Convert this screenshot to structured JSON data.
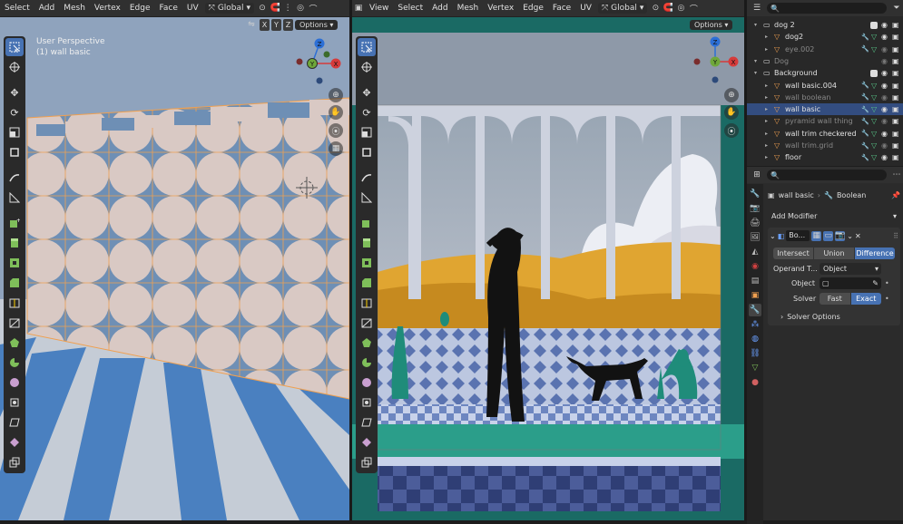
{
  "left_header": {
    "menus": [
      "Select",
      "Add",
      "Mesh",
      "Vertex",
      "Edge",
      "Face",
      "UV"
    ],
    "transform_orientation": "Global",
    "options_label": "Options",
    "axes": [
      "X",
      "Y",
      "Z"
    ]
  },
  "left_viewport": {
    "view_name": "User Perspective",
    "object_label": "(1) wall basic"
  },
  "right_header": {
    "menus": [
      "View",
      "Select",
      "Add",
      "Mesh",
      "Vertex",
      "Edge",
      "Face",
      "UV"
    ],
    "transform_orientation": "Global",
    "options_label": "Options"
  },
  "gizmo": {
    "x": "X",
    "y": "Y",
    "z": "Z"
  },
  "outliner": {
    "rows": [
      {
        "name": "dog 2",
        "type": "collection",
        "indent": 0,
        "checked": true
      },
      {
        "name": "dog2",
        "type": "object",
        "indent": 1
      },
      {
        "name": "eye.002",
        "type": "object",
        "indent": 1,
        "dim": true
      },
      {
        "name": "Dog",
        "type": "collection",
        "indent": 0,
        "dim": true
      },
      {
        "name": "Background",
        "type": "collection",
        "indent": 0,
        "checked": true
      },
      {
        "name": "wall basic.004",
        "type": "object",
        "indent": 1
      },
      {
        "name": "wall boolean",
        "type": "object",
        "indent": 1,
        "dim": true
      },
      {
        "name": "wall basic",
        "type": "object",
        "indent": 1,
        "selected": true
      },
      {
        "name": "pyramid wall thing",
        "type": "object",
        "indent": 1,
        "dim": true
      },
      {
        "name": "wall trim checkered",
        "type": "object",
        "indent": 1
      },
      {
        "name": "wall trim.grid",
        "type": "object",
        "indent": 1,
        "dim": true
      },
      {
        "name": "floor",
        "type": "object",
        "indent": 1
      }
    ]
  },
  "properties": {
    "breadcrumb_object": "wall basic",
    "breadcrumb_modifier": "Boolean",
    "add_modifier_label": "Add Modifier",
    "modifier_name": "Bo...",
    "operations": [
      "Intersect",
      "Union",
      "Difference"
    ],
    "active_operation": "Difference",
    "operand_label": "Operand T...",
    "operand_value": "Object",
    "object_label": "Object",
    "object_value": "",
    "solver_label": "Solver",
    "solvers": [
      "Fast",
      "Exact"
    ],
    "active_solver": "Exact",
    "solver_options_label": "Solver Options"
  },
  "colors": {
    "accent": "#4772b3",
    "selected_row": "#334d80",
    "wall_beige": "#d9c9c4",
    "wall_blue": "#6e8fb5",
    "floor_stripe": "#4a80c0",
    "edge_orange": "#f0a050",
    "bg_yellow": "#e0a531",
    "teal": "#2b9e8a"
  }
}
